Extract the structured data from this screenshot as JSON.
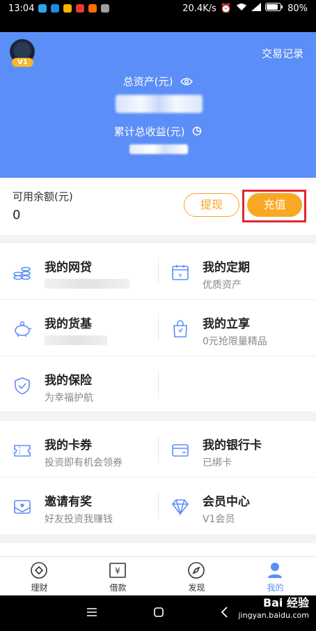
{
  "status": {
    "time": "13:04",
    "speed": "20.4K/s",
    "battery": "80%"
  },
  "header": {
    "vip": "V1",
    "trade_record": "交易记录",
    "total_assets_label": "总资产(元)",
    "cum_income_label": "累计总收益(元)"
  },
  "balance": {
    "label": "可用余额(元)",
    "value": "0",
    "withdraw": "提现",
    "recharge": "充值"
  },
  "menu": {
    "wangdai": {
      "title": "我的网贷"
    },
    "dingqi": {
      "title": "我的定期",
      "sub": "优质资产"
    },
    "huoji": {
      "title": "我的货基"
    },
    "lixiang": {
      "title": "我的立享",
      "sub": "0元抢限量精品"
    },
    "baoxian": {
      "title": "我的保险",
      "sub": "为幸福护航"
    },
    "kaquan": {
      "title": "我的卡券",
      "sub": "投资即有机会领券"
    },
    "yinhangka": {
      "title": "我的银行卡",
      "sub": "已绑卡"
    },
    "yaoqing": {
      "title": "邀请有奖",
      "sub": "好友投资我赚钱"
    },
    "huiyuan": {
      "title": "会员中心",
      "sub": "V1会员"
    }
  },
  "tabs": {
    "licai": "理财",
    "jiekuan": "借款",
    "faxian": "发现",
    "wode": "我的"
  },
  "colors": {
    "brand": "#5b8ef7",
    "accent": "#f9a825",
    "highlight": "#e0262e"
  },
  "watermark": {
    "logo": "Bai 经验",
    "url": "jingyan.baidu.com"
  }
}
